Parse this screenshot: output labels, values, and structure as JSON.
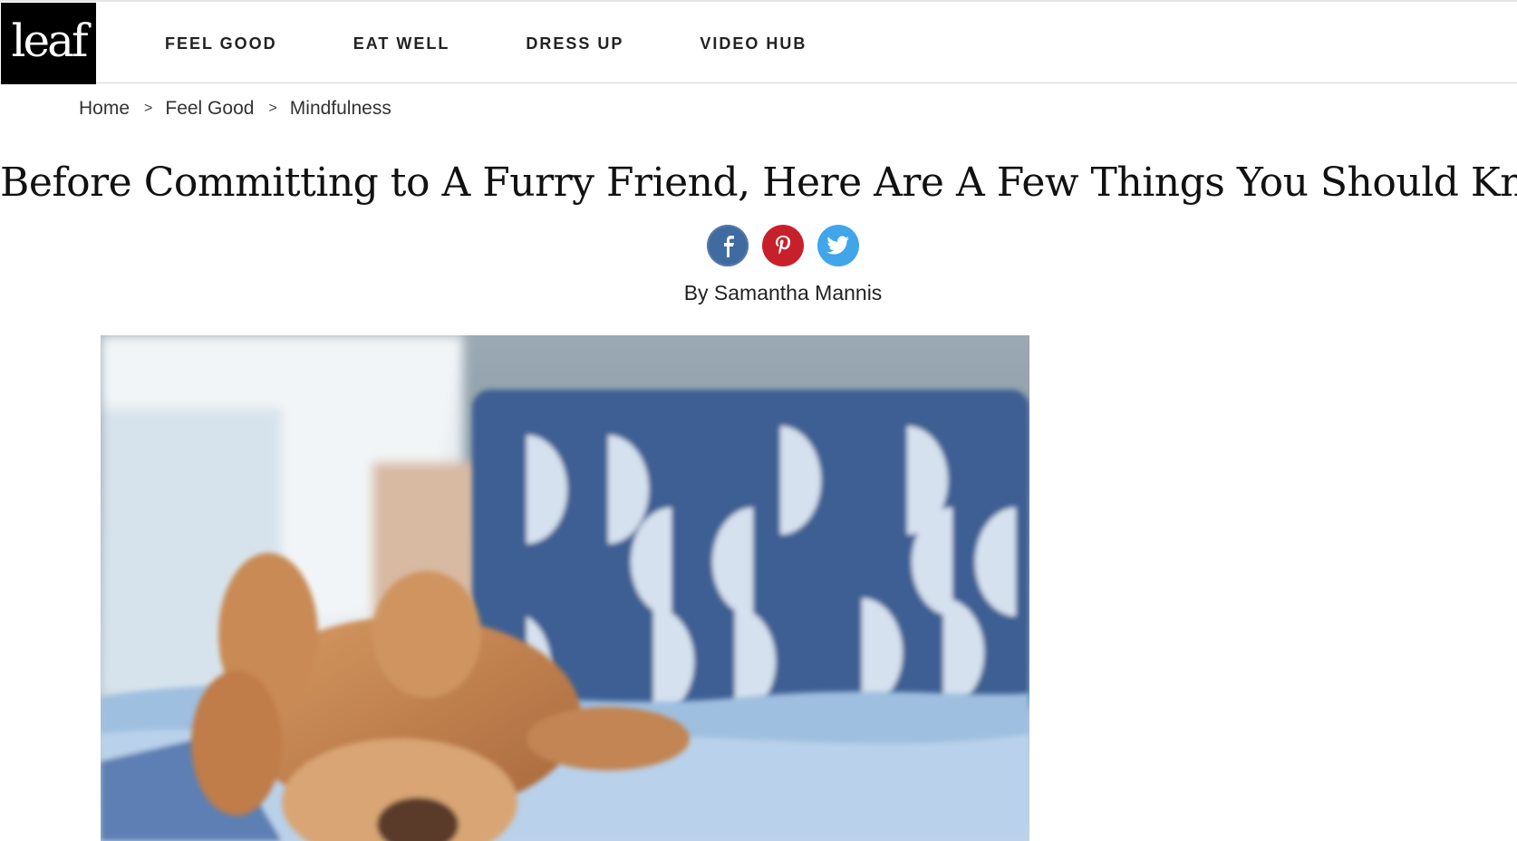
{
  "brand": {
    "logo_text": "leaf"
  },
  "nav": {
    "items": [
      {
        "label": "FEEL GOOD"
      },
      {
        "label": "EAT WELL"
      },
      {
        "label": "DRESS UP"
      },
      {
        "label": "VIDEO HUB"
      }
    ]
  },
  "breadcrumb": {
    "items": [
      {
        "label": "Home"
      },
      {
        "label": "Feel Good"
      },
      {
        "label": "Mindfulness"
      }
    ],
    "separator": ">"
  },
  "article": {
    "title": "Before Committing to A Furry Friend, Here Are A Few Things You Should Know",
    "byline": "By Samantha Mannis"
  },
  "social": {
    "facebook_icon": "facebook-icon",
    "pinterest_icon": "pinterest-icon",
    "twitter_icon": "twitter-icon",
    "colors": {
      "facebook": "#3f6ba1",
      "pinterest": "#c8202a",
      "twitter": "#41a5ea"
    }
  },
  "colors": {
    "logo_bg": "#000000",
    "text": "#222222"
  }
}
